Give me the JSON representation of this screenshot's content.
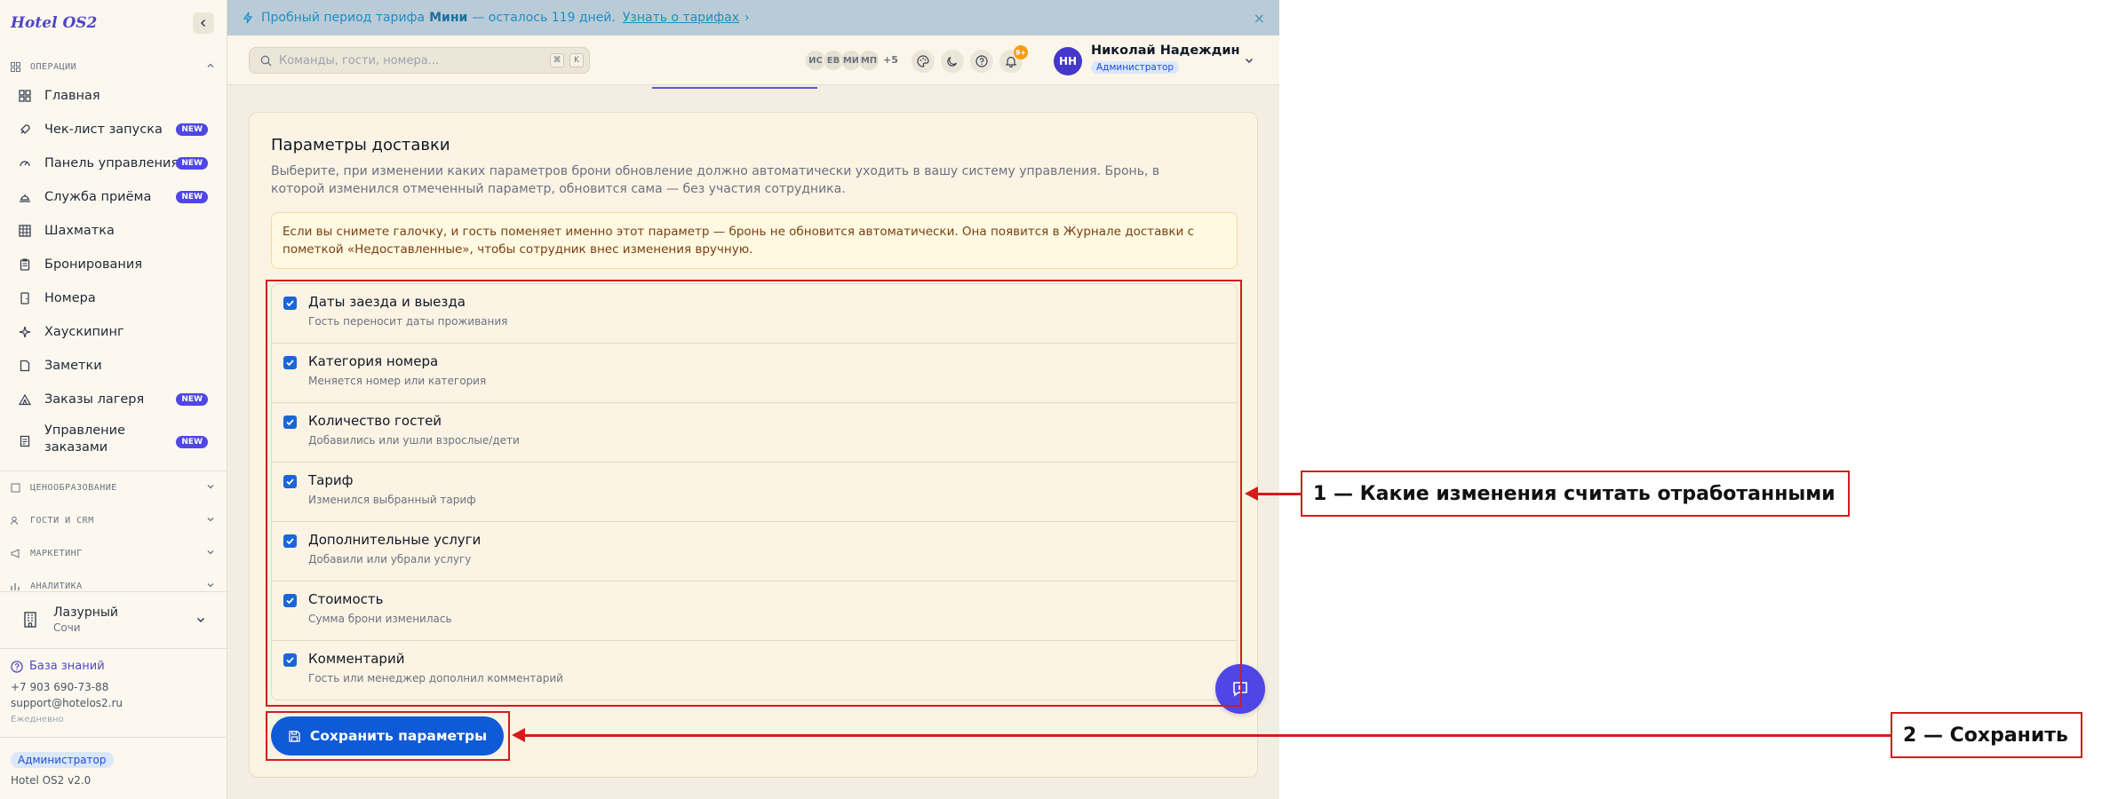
{
  "sidebar": {
    "brand": "Hotel OS2",
    "sections": {
      "operations": "ОПЕРАЦИИ",
      "pricing": "ЦЕНООБРАЗОВАНИЕ",
      "guests_crm": "ГОСТИ И CRM",
      "marketing": "МАРКЕТИНГ",
      "analytics": "АНАЛИТИКА"
    },
    "items": [
      {
        "label": "Главная",
        "icon": "home-grid-icon",
        "badge": ""
      },
      {
        "label": "Чек-лист запуска",
        "icon": "rocket-icon",
        "badge": "NEW"
      },
      {
        "label": "Панель управления",
        "icon": "gauge-icon",
        "badge": "NEW"
      },
      {
        "label": "Служба приёма",
        "icon": "bell-desk-icon",
        "badge": "NEW"
      },
      {
        "label": "Шахматка",
        "icon": "grid-icon",
        "badge": ""
      },
      {
        "label": "Бронирования",
        "icon": "clipboard-icon",
        "badge": ""
      },
      {
        "label": "Номера",
        "icon": "door-icon",
        "badge": ""
      },
      {
        "label": "Хаускипинг",
        "icon": "sparkle-icon",
        "badge": ""
      },
      {
        "label": "Заметки",
        "icon": "note-icon",
        "badge": ""
      },
      {
        "label": "Заказы лагеря",
        "icon": "tent-icon",
        "badge": "NEW"
      },
      {
        "label": "Управление заказами",
        "icon": "receipt-icon",
        "badge": "NEW"
      }
    ],
    "hotel": {
      "name": "Лазурный",
      "city": "Сочи"
    },
    "knowledge_base": "База знаний",
    "phone": "+7 903 690-73-88",
    "email": "support@hotelos2.ru",
    "hours": "Ежедневно",
    "role": "Администратор",
    "version": "Hotel OS2 v2.0"
  },
  "banner": {
    "prefix": "Пробный период тарифа",
    "plan": "Мини",
    "suffix": "— осталось 119 дней.",
    "link": "Узнать о тарифах",
    "arrow": "›",
    "close": "×"
  },
  "topbar": {
    "search_placeholder": "Команды, гости, номера...",
    "kbd1": "⌘",
    "kbd2": "K",
    "avatars": [
      "ИС",
      "ЕВ",
      "МИ",
      "МП"
    ],
    "more": "+5",
    "notifications": "9+",
    "user": {
      "initials": "НН",
      "name": "Николай Надеждин",
      "role": "Администратор"
    }
  },
  "card": {
    "title": "Параметры доставки",
    "description": "Выберите, при изменении каких параметров брони обновление должно автоматически уходить в вашу систему управления. Бронь, в которой изменился отмеченный параметр, обновится сама — без участия сотрудника.",
    "warning": "Если вы снимете галочку, и гость поменяет именно этот параметр — бронь не обновится автоматически. Она появится в Журнале доставки с пометкой «Недоставленные», чтобы сотрудник внес изменения вручную.",
    "options": [
      {
        "title": "Даты заезда и выезда",
        "subtitle": "Гость переносит даты проживания",
        "checked": true
      },
      {
        "title": "Категория номера",
        "subtitle": "Меняется номер или категория",
        "checked": true
      },
      {
        "title": "Количество гостей",
        "subtitle": "Добавились или ушли взрослые/дети",
        "checked": true
      },
      {
        "title": "Тариф",
        "subtitle": "Изменился выбранный тариф",
        "checked": true
      },
      {
        "title": "Дополнительные услуги",
        "subtitle": "Добавили или убрали услугу",
        "checked": true
      },
      {
        "title": "Стоимость",
        "subtitle": "Сумма брони изменилась",
        "checked": true
      },
      {
        "title": "Комментарий",
        "subtitle": "Гость или менеджер дополнил комментарий",
        "checked": true
      }
    ],
    "save_label": "Сохранить параметры"
  },
  "annotations": {
    "a1": "1 — Какие изменения считать отработанными",
    "a2": "2 — Сохранить"
  },
  "colors": {
    "accent": "#4f46e5",
    "primary_button": "#0f5bd7",
    "annotation": "#d31c1c",
    "badge_new": "#4f46e5"
  }
}
